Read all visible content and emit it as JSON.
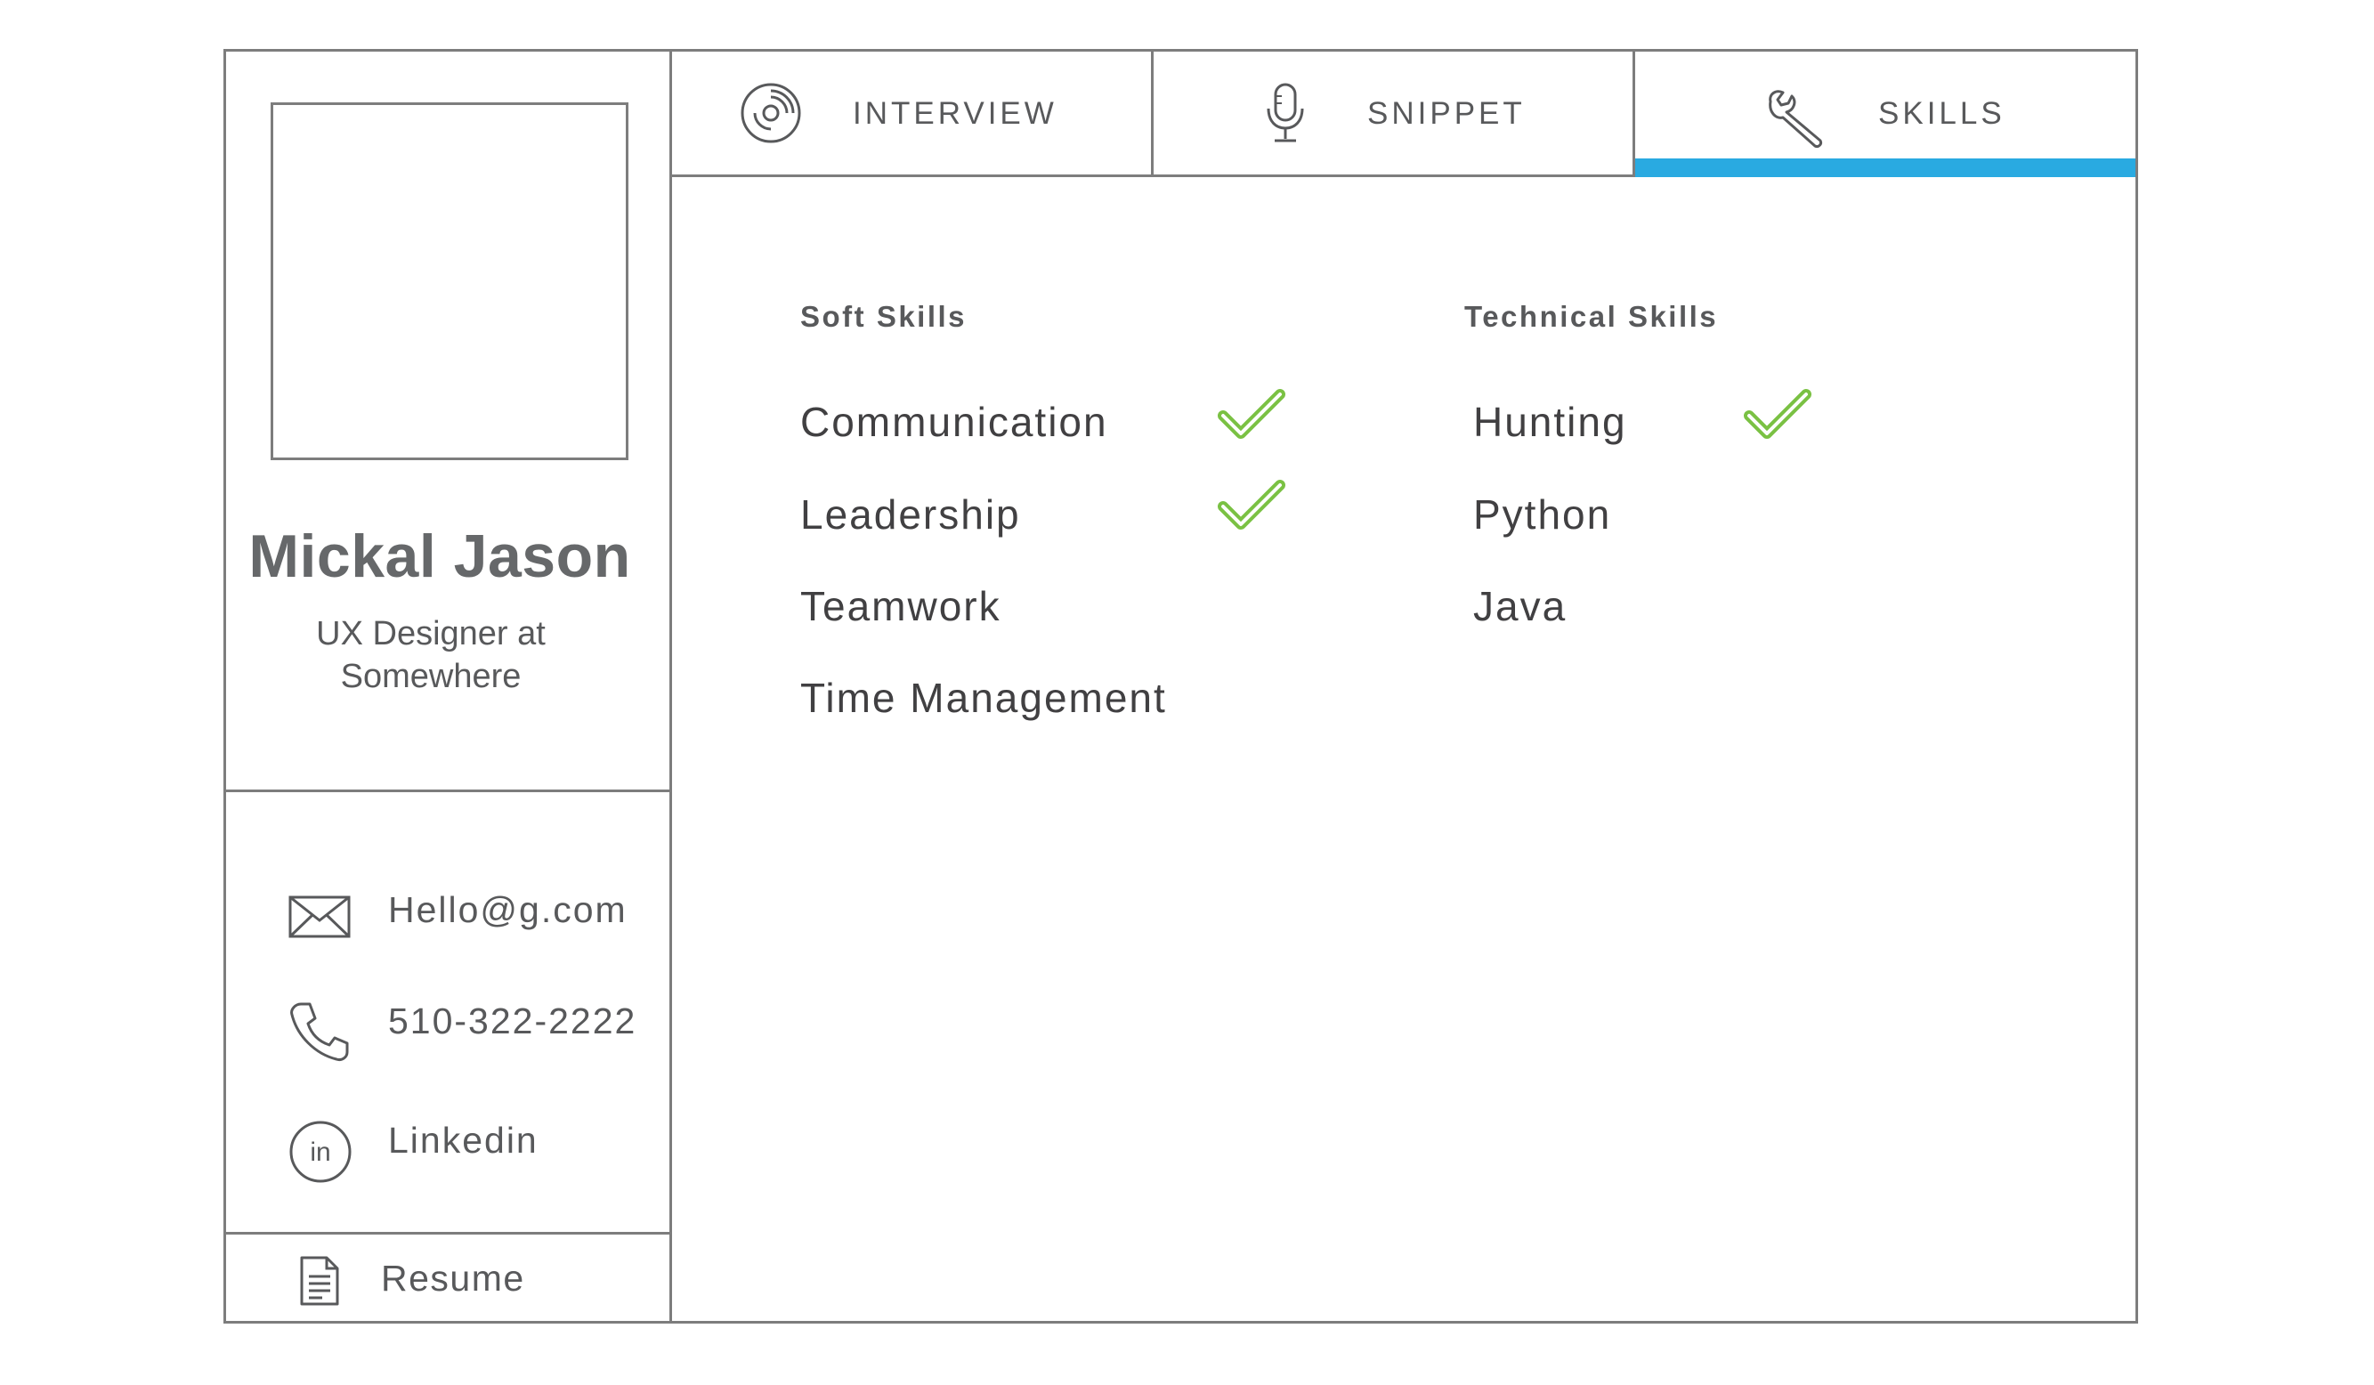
{
  "profile": {
    "name": "Mickal Jason",
    "title_line1": "UX Designer at",
    "title_line2": "Somewhere"
  },
  "contacts": [
    {
      "icon": "envelope-icon",
      "label": "Hello@g.com"
    },
    {
      "icon": "phone-icon",
      "label": "510-322-2222"
    },
    {
      "icon": "linkedin-icon",
      "label": "Linkedin"
    }
  ],
  "resume": {
    "icon": "document-icon",
    "label": "Resume"
  },
  "tabs": [
    {
      "icon": "disc-icon",
      "label": "INTERVIEW",
      "active": false
    },
    {
      "icon": "microphone-icon",
      "label": "SNIPPET",
      "active": false
    },
    {
      "icon": "wrench-icon",
      "label": "SKILLS",
      "active": true
    }
  ],
  "skills": {
    "soft": {
      "heading": "Soft Skills",
      "items": [
        {
          "label": "Communication",
          "checked": true
        },
        {
          "label": "Leadership",
          "checked": true
        },
        {
          "label": "Teamwork",
          "checked": false
        },
        {
          "label": "Time Management",
          "checked": false
        }
      ]
    },
    "technical": {
      "heading": "Technical Skills",
      "items": [
        {
          "label": "Hunting",
          "checked": true
        },
        {
          "label": "Python",
          "checked": false
        },
        {
          "label": "Java",
          "checked": false
        }
      ]
    }
  },
  "colors": {
    "accent": "#29aae1",
    "check": "#7ac143",
    "border": "#7d7d7d",
    "text": "#58595b"
  }
}
